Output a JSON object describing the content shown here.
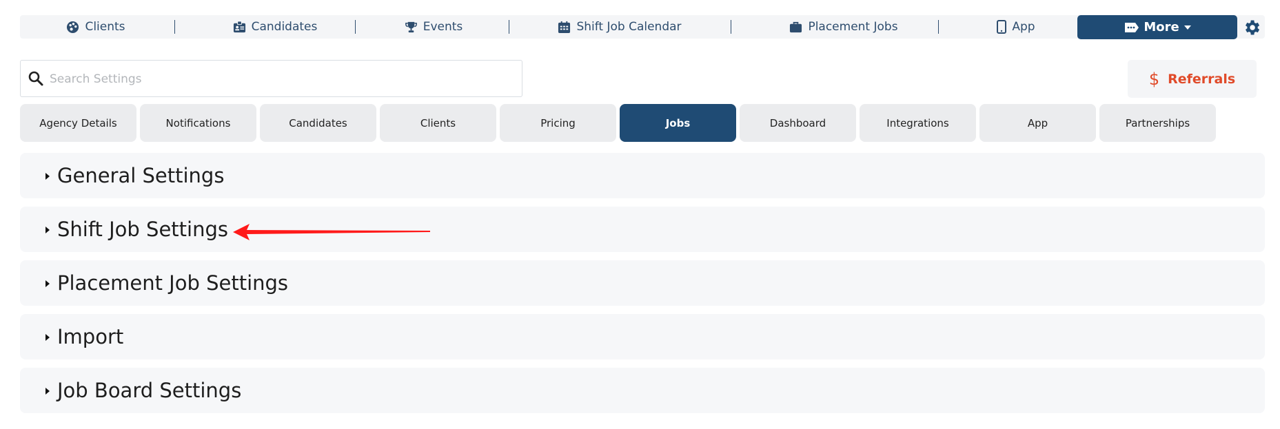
{
  "topnav": {
    "items": [
      {
        "label": "Clients",
        "icon": "palette-icon"
      },
      {
        "label": "Candidates",
        "icon": "id-badge-icon"
      },
      {
        "label": "Events",
        "icon": "trophy-icon"
      },
      {
        "label": "Shift Job Calendar",
        "icon": "calendar-icon"
      },
      {
        "label": "Placement Jobs",
        "icon": "briefcase-icon"
      },
      {
        "label": "App",
        "icon": "mobile-phone-icon"
      }
    ],
    "more_label": "More",
    "more_icon": "tags-icon",
    "settings_icon": "gear-icon"
  },
  "search": {
    "placeholder": "Search Settings",
    "value": ""
  },
  "referrals": {
    "label": "Referrals",
    "icon": "dollar-icon"
  },
  "tabs": [
    {
      "label": "Agency Details",
      "active": false
    },
    {
      "label": "Notifications",
      "active": false
    },
    {
      "label": "Candidates",
      "active": false
    },
    {
      "label": "Clients",
      "active": false
    },
    {
      "label": "Pricing",
      "active": false
    },
    {
      "label": "Jobs",
      "active": true
    },
    {
      "label": "Dashboard",
      "active": false
    },
    {
      "label": "Integrations",
      "active": false
    },
    {
      "label": "App",
      "active": false
    },
    {
      "label": "Partnerships",
      "active": false
    }
  ],
  "sections": [
    {
      "title": "General Settings"
    },
    {
      "title": "Shift Job Settings"
    },
    {
      "title": "Placement Job Settings"
    },
    {
      "title": "Import"
    },
    {
      "title": "Job Board Settings"
    }
  ],
  "colors": {
    "primary": "#1f4b74",
    "accent_red": "#e04b2a",
    "annotation_arrow": "#ff1a1a"
  }
}
